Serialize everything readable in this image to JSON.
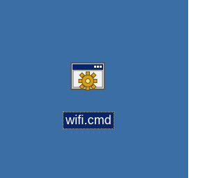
{
  "desktop": {
    "background": "#3A6EA5",
    "item": {
      "name": "wifi.cmd",
      "icon": "batch-file-gear-icon",
      "selected": true,
      "selection_color": "#0A246A"
    }
  }
}
